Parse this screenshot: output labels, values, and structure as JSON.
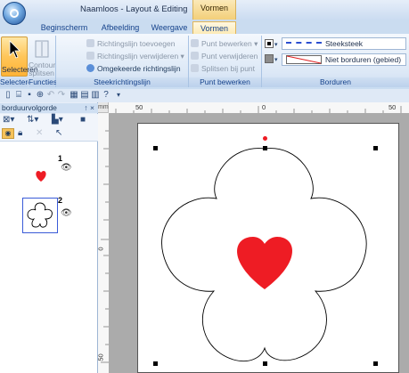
{
  "window": {
    "title": "Naamloos - Layout & Editing",
    "context_tab_group": "Vormen"
  },
  "tabs": [
    {
      "label": "Beginscherm"
    },
    {
      "label": "Afbeelding"
    },
    {
      "label": "Weergave"
    },
    {
      "label": "Vormen",
      "active": true
    }
  ],
  "ribbon": {
    "select_label": "Selecteren",
    "contour_label": "Contour splitsen",
    "stitch_direction": {
      "add": "Richtingslijn toevoegen",
      "remove": "Richtingslijn verwijderen",
      "reverse": "Omgekeerde richtingslijn"
    },
    "point_edit": {
      "edit": "Punt bewerken",
      "delete": "Punt verwijderen",
      "split": "Splitsen bij punt"
    },
    "embroidery": {
      "line_stitch": "Steeksteek",
      "region_stitch": "Niet borduren (gebied)"
    },
    "groups": {
      "select": "Selecteren",
      "functions": "Functies",
      "stitch_direction": "Steekrichtingslijn",
      "point_edit": "Punt bewerken",
      "embroidery": "Borduren"
    }
  },
  "panel": {
    "title": "borduurvolgorde",
    "pin": "↑ ×",
    "items": [
      {
        "number": "1",
        "shape": "heart",
        "color": "#ee1c24"
      },
      {
        "number": "2",
        "shape": "flower",
        "selected": true
      }
    ]
  },
  "rulers": {
    "top": [
      "50",
      "0",
      "50"
    ],
    "left": [
      "0",
      "50"
    ]
  },
  "colors": {
    "heart": "#ee1c24",
    "accent": "#f6c25a",
    "page": "#ffffff",
    "canvas": "#ababab"
  }
}
